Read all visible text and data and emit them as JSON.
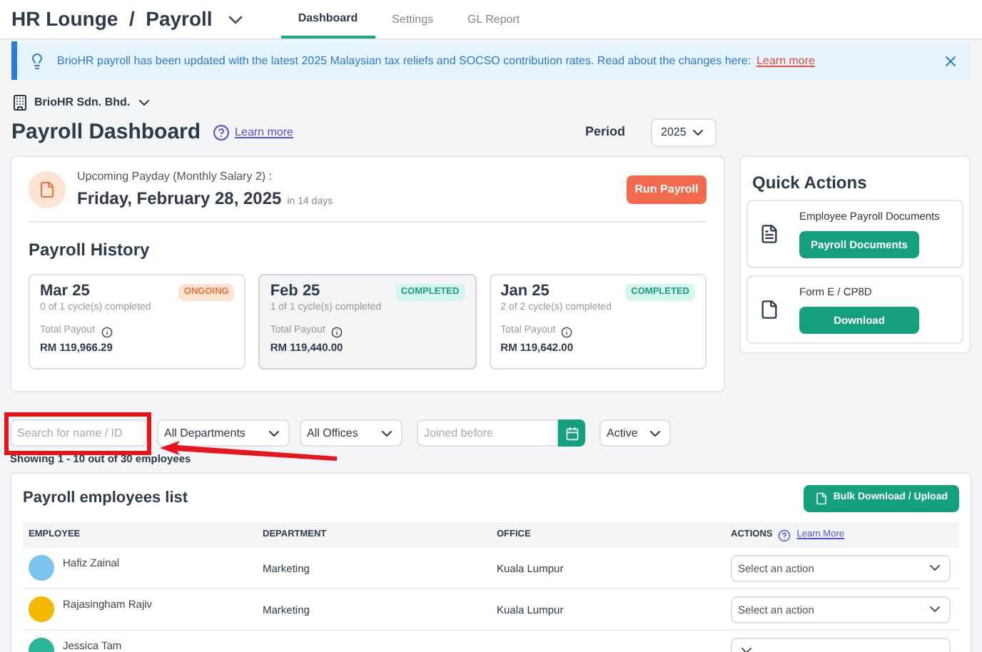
{
  "header": {
    "breadcrumb": [
      "HR Lounge",
      "Payroll"
    ],
    "separator": "/",
    "tabs": [
      {
        "label": "Dashboard",
        "selected": true
      },
      {
        "label": "Settings",
        "selected": false
      },
      {
        "label": "GL Report",
        "selected": false
      }
    ]
  },
  "banner": {
    "text": "BrioHR payroll has been updated with the latest 2025 Malaysian tax reliefs and SOCSO contribution rates. Read about the changes here:",
    "link": "Learn more"
  },
  "company": "BrioHR Sdn. Bhd.",
  "page": {
    "title": "Payroll Dashboard",
    "learn_more": "Learn more",
    "period_label": "Period",
    "period": "2025"
  },
  "upcoming": {
    "label": "Upcoming Payday (Monthly Salary 2) :",
    "date": "Friday, February 28, 2025",
    "relative": "in 14 days",
    "button": "Run Payroll"
  },
  "history": {
    "title": "Payroll History",
    "cards": [
      {
        "month": "Mar 25",
        "status": "ONGOING",
        "kind": "ongoing",
        "cycles": "0 of 1 cycle(s) completed",
        "payout_label": "Total Payout",
        "payout": "RM 119,966.29",
        "selected": false
      },
      {
        "month": "Feb 25",
        "status": "COMPLETED",
        "kind": "completed",
        "cycles": "1 of 1 cycle(s) completed",
        "payout_label": "Total Payout",
        "payout": "RM 119,440.00",
        "selected": true
      },
      {
        "month": "Jan 25",
        "status": "COMPLETED",
        "kind": "completed",
        "cycles": "2 of 2 cycle(s) completed",
        "payout_label": "Total Payout",
        "payout": "RM 119,642.00",
        "selected": false
      }
    ]
  },
  "quick_actions": {
    "title": "Quick Actions",
    "items": [
      {
        "label": "Employee Payroll Documents",
        "button": "Payroll Documents",
        "kind": "payslip"
      },
      {
        "label": "Form E / CP8D",
        "button": "Download",
        "kind": "document"
      }
    ]
  },
  "filters": {
    "search_placeholder": "Search for name / ID",
    "department": "All Departments",
    "office": "All Offices",
    "joined_placeholder": "Joined before",
    "status": "Active"
  },
  "showing": "Showing 1 - 10 out of 30 employees",
  "list": {
    "title": "Payroll employees list",
    "bulk_button": "Bulk Download / Upload",
    "columns": [
      "EMPLOYEE",
      "DEPARTMENT",
      "OFFICE",
      "ACTIONS"
    ],
    "actions_link": "Learn More",
    "rows": [
      {
        "name": "Hafiz Zainal",
        "department": "Marketing",
        "office": "Kuala Lumpur",
        "action_placeholder": "Select an action",
        "color": "#7cc4f0"
      },
      {
        "name": "Rajasingham Rajiv",
        "department": "Marketing",
        "office": "Kuala Lumpur",
        "action_placeholder": "Select an action",
        "color": "#f5b800"
      },
      {
        "name": "Jessica Tam",
        "color": "#2bb59a"
      }
    ]
  }
}
